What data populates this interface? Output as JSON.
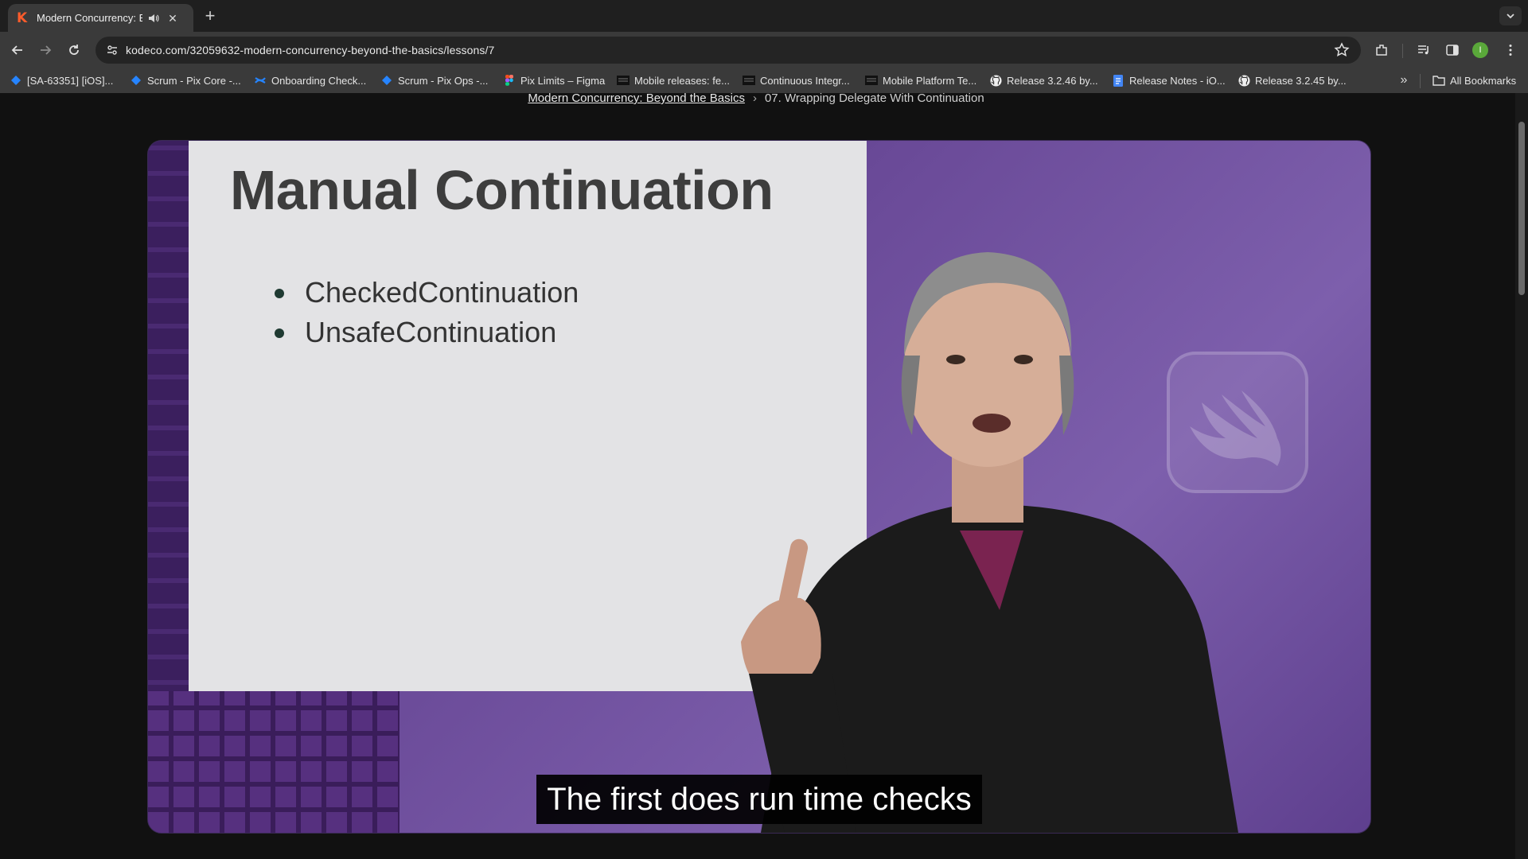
{
  "browser": {
    "tab": {
      "title": "Modern Concurrency: Beyond the Basics",
      "favicon": "kodeco-k-icon",
      "audio_icon": "speaker-icon"
    },
    "url": "kodeco.com/32059632-modern-concurrency-beyond-the-basics/lessons/7",
    "avatar_initial": "I",
    "bookmarks": [
      {
        "label": "[SA-63351] [iOS]...",
        "icon": "jira-icon"
      },
      {
        "label": "Scrum - Pix Core -...",
        "icon": "jira-icon"
      },
      {
        "label": "Onboarding Check...",
        "icon": "confluence-icon"
      },
      {
        "label": "Scrum - Pix Ops -...",
        "icon": "jira-icon"
      },
      {
        "label": "Pix Limits – Figma",
        "icon": "figma-icon"
      },
      {
        "label": "Mobile releases: fe...",
        "icon": "page-icon"
      },
      {
        "label": "Continuous Integr...",
        "icon": "page-icon"
      },
      {
        "label": "Mobile Platform Te...",
        "icon": "page-icon"
      },
      {
        "label": "Release 3.2.46 by...",
        "icon": "github-icon"
      },
      {
        "label": "Release Notes - iO...",
        "icon": "docs-icon"
      },
      {
        "label": "Release 3.2.45 by...",
        "icon": "github-icon"
      }
    ],
    "all_bookmarks_label": "All Bookmarks"
  },
  "page": {
    "breadcrumb": {
      "course": "Modern Concurrency: Beyond the Basics",
      "lesson": "07. Wrapping Delegate With Continuation"
    },
    "video": {
      "slide_title": "Manual Continuation",
      "bullets": [
        "CheckedContinuation",
        "UnsafeContinuation"
      ],
      "subtitle": "The first does run time checks"
    }
  },
  "colors": {
    "accent": "#ff5c2b",
    "video_bg": "#6a4a98",
    "slide_bg": "#e3e3e5"
  }
}
